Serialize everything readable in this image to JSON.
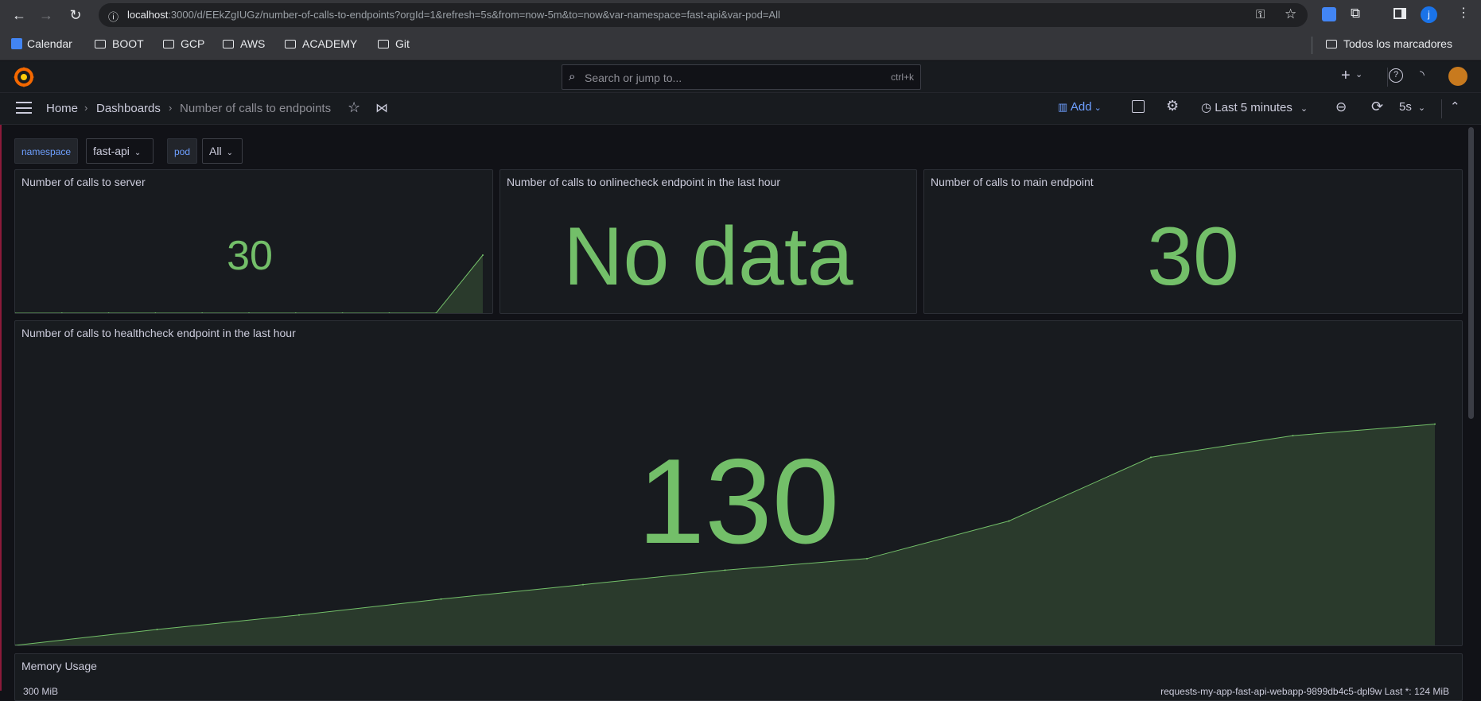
{
  "browser": {
    "url_host": "localhost",
    "url_path": ":3000/d/EEkZgIUGz/number-of-calls-to-endpoints?orgId=1&refresh=5s&from=now-5m&to=now&var-namespace=fast-api&var-pod=All",
    "bookmarks": [
      "Calendar",
      "BOOT",
      "GCP",
      "AWS",
      "ACADEMY",
      "Git"
    ],
    "all_bookmarks": "Todos los marcadores",
    "profile_initial": "j"
  },
  "grafana": {
    "search_placeholder": "Search or jump to...",
    "search_shortcut": "ctrl+k",
    "breadcrumbs": [
      "Home",
      "Dashboards",
      "Number of calls to endpoints"
    ],
    "add_label": "Add",
    "time_range": "Last 5 minutes",
    "refresh_interval": "5s"
  },
  "variables": [
    {
      "label": "namespace",
      "value": "fast-api"
    },
    {
      "label": "pod",
      "value": "All"
    }
  ],
  "panels": {
    "server": {
      "title": "Number of calls to server",
      "value": "30"
    },
    "onlinecheck": {
      "title": "Number of calls to onlinecheck endpoint in the last hour",
      "value": "No data"
    },
    "main": {
      "title": "Number of calls to main endpoint",
      "value": "30"
    },
    "healthcheck": {
      "title": "Number of calls to healthcheck endpoint in the last hour",
      "value": "130"
    },
    "memory": {
      "title": "Memory Usage",
      "partial_axis_label": "300 MiB",
      "partial_legend": "requests-my-app-fast-api-webapp-9899db4c5-dpl9w  Last *: 124 MiB"
    }
  },
  "chart_data": [
    {
      "type": "area",
      "title": "Number of calls to server",
      "x": [
        0,
        1,
        2,
        3,
        4,
        5,
        6,
        7,
        8,
        9,
        10
      ],
      "values": [
        0,
        0,
        0,
        0,
        0,
        0,
        0,
        0,
        0,
        0,
        30
      ],
      "ylim": [
        0,
        30
      ]
    },
    {
      "type": "area",
      "title": "Number of calls to healthcheck endpoint in the last hour",
      "x": [
        0,
        1,
        2,
        3,
        4,
        5,
        6,
        7,
        8,
        9,
        10
      ],
      "values": [
        0,
        11,
        21,
        32,
        42,
        52,
        60,
        86,
        130,
        145,
        153
      ],
      "ylim": [
        0,
        172
      ]
    }
  ],
  "colors": {
    "accent_green": "#73bf69",
    "fill_green": "#2a3a2c",
    "link_blue": "#6e9fff"
  }
}
